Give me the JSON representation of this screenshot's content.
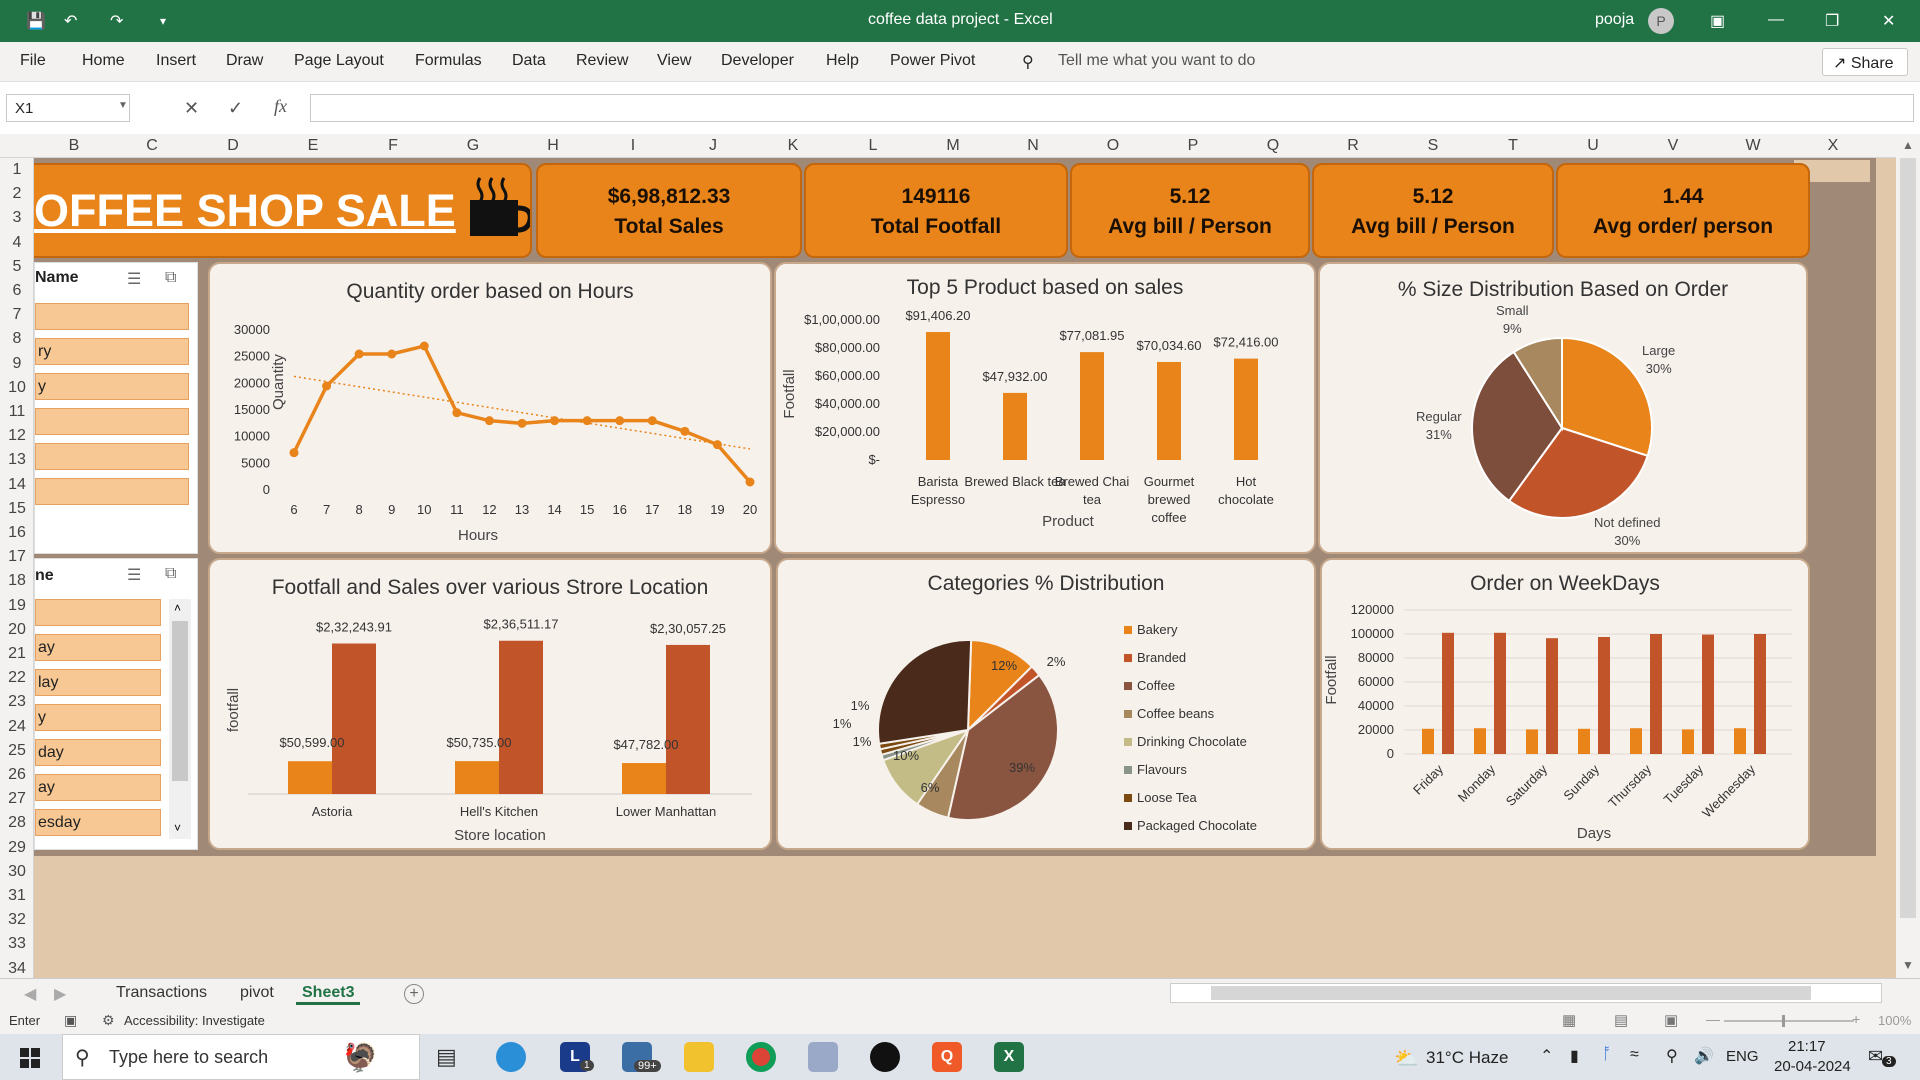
{
  "window": {
    "title": "coffee data project  -  Excel",
    "user": "pooja",
    "avatar": "P",
    "share": "Share"
  },
  "menu": [
    "File",
    "Home",
    "Insert",
    "Draw",
    "Page Layout",
    "Formulas",
    "Data",
    "Review",
    "View",
    "Developer",
    "Help",
    "Power Pivot"
  ],
  "tell_me": "Tell me what you want to do",
  "name_box": "X1",
  "columns": [
    "B",
    "C",
    "D",
    "E",
    "F",
    "G",
    "H",
    "I",
    "J",
    "K",
    "L",
    "M",
    "N",
    "O",
    "P",
    "Q",
    "R",
    "S",
    "T",
    "U",
    "V",
    "W",
    "X"
  ],
  "rows": [
    "1",
    "2",
    "3",
    "4",
    "5",
    "6",
    "7",
    "8",
    "9",
    "10",
    "11",
    "12",
    "13",
    "14",
    "15",
    "16",
    "17",
    "18",
    "19",
    "20",
    "21",
    "22",
    "23",
    "24",
    "25",
    "26",
    "27",
    "28",
    "29",
    "30",
    "31",
    "32",
    "33",
    "34"
  ],
  "banner": "OFFEE SHOP SALE",
  "kpis": [
    {
      "value": "$6,98,812.33",
      "label": "Total Sales"
    },
    {
      "value": "149116",
      "label": "Total Footfall"
    },
    {
      "value": "5.12",
      "label": "Avg bill / Person"
    },
    {
      "value": "5.12",
      "label": "Avg bill / Person"
    },
    {
      "value": "1.44",
      "label": "Avg order/ person"
    }
  ],
  "slicer1": {
    "header": "Name",
    "items": [
      "",
      "ry",
      "y",
      "",
      "",
      ""
    ]
  },
  "slicer2": {
    "header": "ne",
    "items": [
      "",
      "ay",
      "lay",
      "y",
      "day",
      "ay",
      "esday"
    ]
  },
  "charts": {
    "hours": {
      "title": "Quantity order based on Hours",
      "xlabel": "Hours",
      "ylabel": "Quantity"
    },
    "top5": {
      "title": "Top 5 Product based on sales",
      "xlabel": "Product",
      "ylabel": "Footfall"
    },
    "size": {
      "title": "%  Size Distribution Based on Order"
    },
    "store": {
      "title": "Footfall and Sales over various Strore Location",
      "xlabel": "Store location",
      "ylabel": "footfall"
    },
    "cat": {
      "title": "Categories  % Distribution"
    },
    "week": {
      "title": "Order on WeekDays",
      "xlabel": "Days",
      "ylabel": "Footfall"
    }
  },
  "chart_data": [
    {
      "type": "line",
      "title": "Quantity order based on Hours",
      "xlabel": "Hours",
      "ylabel": "Quantity",
      "x": [
        6,
        7,
        8,
        9,
        10,
        11,
        12,
        13,
        14,
        15,
        16,
        17,
        18,
        19,
        20
      ],
      "values": [
        7000,
        19500,
        25500,
        25500,
        27000,
        14500,
        13000,
        12500,
        13000,
        13000,
        13000,
        13000,
        11000,
        8500,
        1500
      ],
      "ylim": [
        0,
        30000
      ],
      "yticks": [
        0,
        5000,
        10000,
        15000,
        20000,
        25000,
        30000
      ],
      "trendline": true
    },
    {
      "type": "bar",
      "title": "Top 5 Product based on sales",
      "xlabel": "Product",
      "ylabel": "Footfall",
      "categories": [
        "Barista Espresso",
        "Brewed Black tea",
        "Brewed Chai tea",
        "Gourmet brewed coffee",
        "Hot chocolate"
      ],
      "values": [
        91406.2,
        47932.0,
        77081.95,
        70034.6,
        72416.0
      ],
      "labels": [
        "$91,406.20",
        "$47,932.00",
        "$77,081.95",
        "$70,034.60",
        "$72,416.00"
      ],
      "yticks": [
        "$-",
        "$20,000.00",
        "$40,000.00",
        "$60,000.00",
        "$80,000.00",
        "$1,00,000.00"
      ],
      "ylim": [
        0,
        100000
      ]
    },
    {
      "type": "pie",
      "title": "%  Size Distribution Based on Order",
      "categories": [
        "Large",
        "Not defined",
        "Regular",
        "Small"
      ],
      "values": [
        30,
        30,
        31,
        9
      ],
      "colors": [
        "#e8841a",
        "#c2542a",
        "#7d4e3c",
        "#a8885e"
      ]
    },
    {
      "type": "bar",
      "title": "Footfall and Sales over various Strore Location",
      "xlabel": "Store location",
      "ylabel": "footfall",
      "categories": [
        "Astoria",
        "Hell's Kitchen",
        "Lower Manhattan"
      ],
      "series": [
        {
          "values": [
            50599,
            50735,
            47782
          ],
          "labels": [
            "$50,599.00",
            "$50,735.00",
            "$47,782.00"
          ]
        },
        {
          "values": [
            232243.91,
            236511.17,
            230057.25
          ],
          "labels": [
            "$2,32,243.91",
            "$2,36,511.17",
            "$2,30,057.25"
          ]
        }
      ]
    },
    {
      "type": "pie",
      "title": "Categories  % Distribution",
      "categories": [
        "Bakery",
        "Branded",
        "Coffee",
        "Coffee beans",
        "Drinking Chocolate",
        "Flavours",
        "Loose Tea",
        "Packaged Chocolate"
      ],
      "values": [
        12,
        2,
        39,
        6,
        10,
        1,
        1,
        1
      ],
      "labels": [
        "12%",
        "2%",
        "39%",
        "6%",
        "10%",
        "1%",
        "1%",
        "1%"
      ],
      "colors": [
        "#e8841a",
        "#c2542a",
        "#8a5540",
        "#a8885e",
        "#c4bc86",
        "#8a9488",
        "#7a4a10",
        "#4a2a1a"
      ]
    },
    {
      "type": "bar",
      "title": "Order on WeekDays",
      "xlabel": "Days",
      "ylabel": "Footfall",
      "categories": [
        "Friday",
        "Monday",
        "Saturday",
        "Sunday",
        "Thursday",
        "Tuesday",
        "Wednesday"
      ],
      "series": [
        {
          "values": [
            21000,
            21500,
            20500,
            21000,
            21500,
            20500,
            21500
          ]
        },
        {
          "values": [
            101000,
            101000,
            96500,
            97500,
            100000,
            99500,
            100000
          ]
        }
      ],
      "ylim": [
        0,
        120000
      ],
      "yticks": [
        0,
        20000,
        40000,
        60000,
        80000,
        100000,
        120000
      ]
    }
  ],
  "size_labels": [
    {
      "name": "Large",
      "pct": "30%"
    },
    {
      "name": "Not defined",
      "pct": "30%"
    },
    {
      "name": "Regular",
      "pct": "31%"
    },
    {
      "name": "Small",
      "pct": "9%"
    }
  ],
  "sheets": [
    "Transactions",
    "pivot",
    "Sheet3"
  ],
  "status": {
    "mode": "Enter",
    "accessibility": "Accessibility: Investigate",
    "zoom": "100%"
  },
  "taskbar": {
    "search": "Type here to search",
    "weather": "31°C  Haze",
    "lang": "ENG",
    "time": "21:17",
    "date": "20-04-2024",
    "mail_badge": "99+",
    "l_badge": "1",
    "notif": "3"
  },
  "colors": {
    "excel_green": "#217346",
    "accent": "#e8841a",
    "accent_dark": "#c2542a"
  }
}
